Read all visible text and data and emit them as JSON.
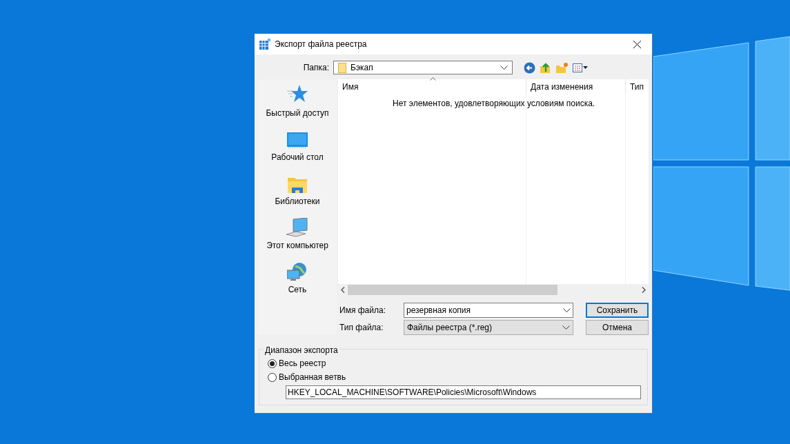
{
  "window": {
    "title": "Экспорт файла реестра"
  },
  "folder": {
    "label": "Папка:",
    "value": "Бэкап"
  },
  "places": [
    {
      "kind": "star",
      "label": "Быстрый доступ"
    },
    {
      "kind": "desktop",
      "label": "Рабочий стол"
    },
    {
      "kind": "library",
      "label": "Библиотеки"
    },
    {
      "kind": "computer",
      "label": "Этот компьютер"
    },
    {
      "kind": "network",
      "label": "Сеть"
    }
  ],
  "file_list": {
    "columns": [
      "Имя",
      "Дата изменения",
      "Тип"
    ],
    "empty_message": "Нет элементов, удовлетворяющих условиям поиска."
  },
  "file_name": {
    "label": "Имя файла:",
    "value": "резервная копия"
  },
  "file_type": {
    "label": "Тип файла:",
    "value": "Файлы реестра (*.reg)"
  },
  "buttons": {
    "save": "Сохранить",
    "cancel": "Отмена"
  },
  "export_range": {
    "title": "Диапазон экспорта",
    "options": [
      {
        "label": "Весь реестр",
        "selected": true
      },
      {
        "label": "Выбранная ветвь",
        "selected": false
      }
    ],
    "branch": "HKEY_LOCAL_MACHINE\\SOFTWARE\\Policies\\Microsoft\\Windows"
  }
}
